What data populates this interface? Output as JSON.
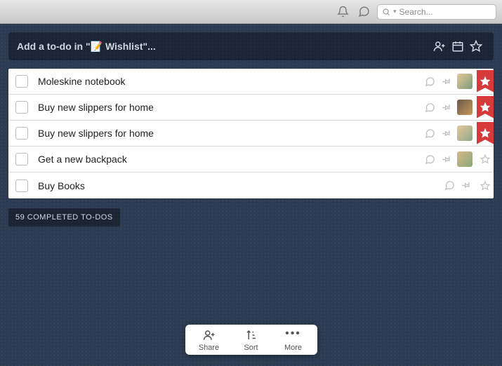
{
  "topbar": {
    "search_placeholder": "Search..."
  },
  "addbar": {
    "placeholder": "Add a to-do in \"📝 Wishlist\"..."
  },
  "todos": [
    {
      "title": "Moleskine notebook",
      "starred": true,
      "avatar": "a1",
      "has_avatar": true
    },
    {
      "title": "Buy new slippers for home",
      "starred": true,
      "avatar": "a2",
      "has_avatar": true
    },
    {
      "title": "Buy new slippers for home",
      "starred": true,
      "avatar": "a3",
      "has_avatar": true
    },
    {
      "title": "Get a new backpack",
      "starred": false,
      "avatar": "a4",
      "has_avatar": true
    },
    {
      "title": "Buy Books",
      "starred": false,
      "avatar": "",
      "has_avatar": false
    }
  ],
  "completed_label": "59 COMPLETED TO-DOS",
  "toolbar": {
    "share": "Share",
    "sort": "Sort",
    "more": "More"
  }
}
